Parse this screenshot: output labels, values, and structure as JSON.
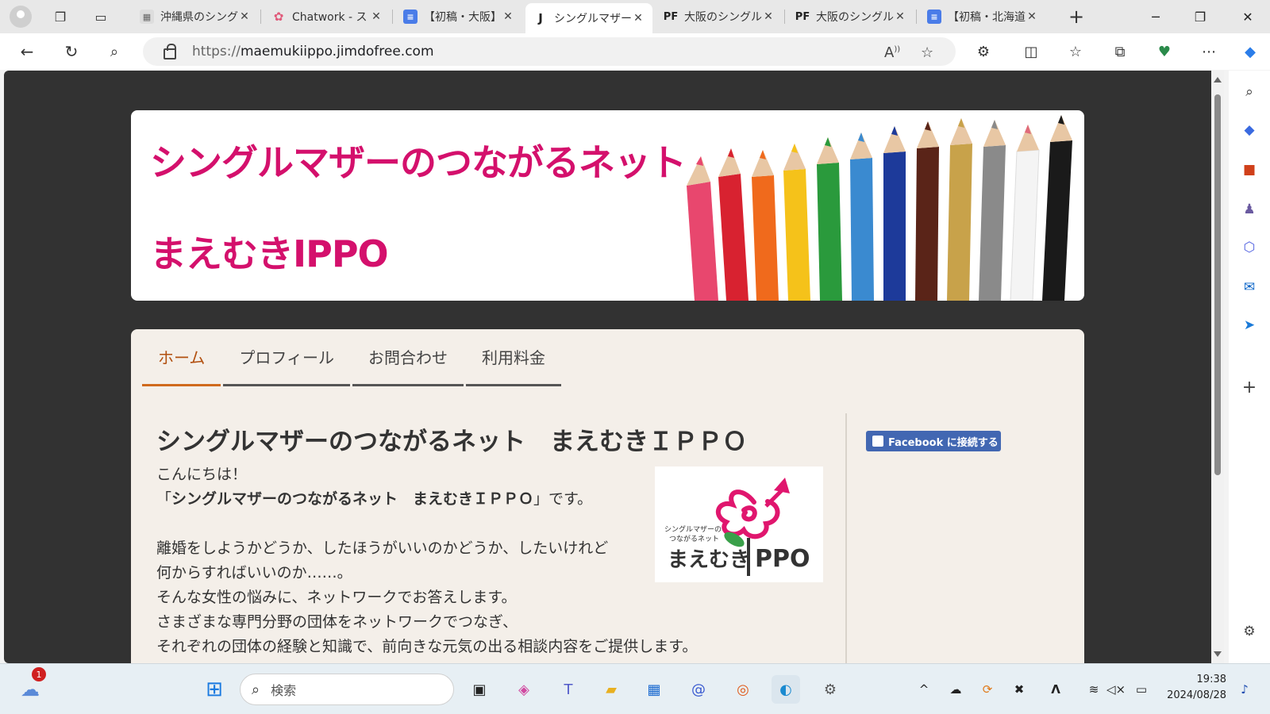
{
  "browser": {
    "tabs": [
      {
        "title": "沖縄県のシングルマザー",
        "active": false
      },
      {
        "title": "Chatwork - ス",
        "active": false
      },
      {
        "title": "【初稿・大阪】",
        "active": false
      },
      {
        "title": "シングルマザーの",
        "active": true
      },
      {
        "title": "大阪のシングル",
        "active": false
      },
      {
        "title": "大阪のシングル",
        "active": false
      },
      {
        "title": "【初稿・北海道",
        "active": false
      }
    ],
    "url_protocol": "https://",
    "url_host": "maemukiippo.jimdofree.com"
  },
  "site": {
    "banner_title_line1": "シングルマザーのつながるネット",
    "banner_title_line2": "まえむきIPPO",
    "nav": [
      "ホーム",
      "プロフィール",
      "お問合わせ",
      "利用料金"
    ],
    "heading": "シングルマザーのつながるネット　まえむきＩＰＰＯ",
    "greeting": "こんにちは！",
    "intro_open": "「",
    "intro_bold": "シングルマザーのつながるネット　まえむきＩＰＰＯ",
    "intro_close": "」です。",
    "para1": "離婚をしようかどうか、したほうがいいのかどうか、したいけれど",
    "para2": "何からすればいいのか……。",
    "para3": "そんな女性の悩みに、ネットワークでお答えします。",
    "para4": "さまざまな専門分野の団体をネットワークでつなぎ、",
    "para5": "それぞれの団体の経験と知識で、前向きな元気の出る相談内容をご提供します。",
    "logo_small1": "シングルマザーの",
    "logo_small2": "つながるネット",
    "logo_main_left": "まえむき",
    "logo_main_right": "PPO",
    "facebook_button": "Facebook に接続する",
    "accent_color": "#d4106c"
  },
  "taskbar": {
    "search_placeholder": "検索",
    "weather_badge": "1",
    "time": "19:38",
    "date": "2024/08/28"
  }
}
